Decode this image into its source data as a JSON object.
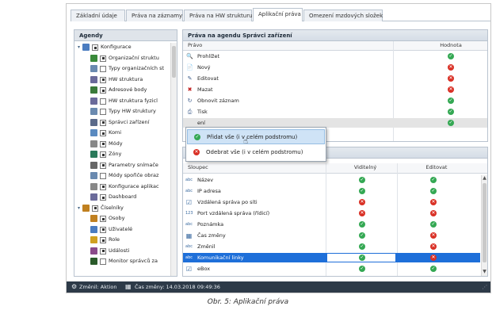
{
  "tabs": [
    "Základní údaje",
    "Práva na záznamy",
    "Práva na HW strukturu",
    "Aplikační práva",
    "Omezení mzdových složek"
  ],
  "left_panel": {
    "title": "Agendy"
  },
  "tree": [
    {
      "label": "Konfigurace",
      "indent": 0,
      "expander": "▾",
      "check": "full",
      "icon_color": "#4a7cc0"
    },
    {
      "label": "Organizační struktu",
      "indent": 1,
      "check": "full",
      "icon_color": "#3a8a3a"
    },
    {
      "label": "Typy organizačních st",
      "indent": 1,
      "check": "empty",
      "icon_color": "#6a8ab0"
    },
    {
      "label": "HW struktura",
      "indent": 1,
      "check": "full",
      "icon_color": "#6a6a9a"
    },
    {
      "label": "Adresové body",
      "indent": 1,
      "check": "full",
      "icon_color": "#3a7a3a"
    },
    {
      "label": "HW struktura fyzicl",
      "indent": 1,
      "check": "empty",
      "icon_color": "#6a6a9a"
    },
    {
      "label": "Typy HW struktury",
      "indent": 1,
      "check": "empty",
      "icon_color": "#6a8ab0"
    },
    {
      "label": "Správci zařízení",
      "indent": 1,
      "check": "full",
      "icon_color": "#5a6a8a"
    },
    {
      "label": "Komi",
      "indent": 1,
      "check": "full",
      "icon_color": "#5a8ac0"
    },
    {
      "label": "Módy",
      "indent": 1,
      "check": "full",
      "icon_color": "#888888"
    },
    {
      "label": "Zóny",
      "indent": 1,
      "check": "full",
      "icon_color": "#2a7a5a"
    },
    {
      "label": "Parametry snímače",
      "indent": 1,
      "check": "full",
      "icon_color": "#666666"
    },
    {
      "label": "Módy spořiče obraz",
      "indent": 1,
      "check": "empty",
      "icon_color": "#6a8ab0"
    },
    {
      "label": "Konfigurace aplikac",
      "indent": 1,
      "check": "full",
      "icon_color": "#888888"
    },
    {
      "label": "Dashboard",
      "indent": 1,
      "check": "full",
      "icon_color": "#6a6a9a"
    },
    {
      "label": "Číselníky",
      "indent": 0,
      "expander": "▾",
      "check": "full",
      "icon_color": "#c08020"
    },
    {
      "label": "Osoby",
      "indent": 1,
      "check": "full",
      "icon_color": "#c08020"
    },
    {
      "label": "Uživatelé",
      "indent": 1,
      "check": "full",
      "icon_color": "#4a7cc0"
    },
    {
      "label": "Role",
      "indent": 1,
      "check": "full",
      "icon_color": "#d0a020"
    },
    {
      "label": "Události",
      "indent": 1,
      "check": "full",
      "icon_color": "#8a4a8a"
    },
    {
      "label": "Monitor správců za",
      "indent": 1,
      "check": "empty",
      "icon_color": "#2a5a2a"
    }
  ],
  "rights_panel": {
    "title": "Práva na agendu Správci zařízení",
    "col_right": "Právo",
    "col_value": "Hodnota",
    "rows": [
      {
        "icon": "magnifier-icon",
        "glyph": "🔍",
        "label": "Prohlížet",
        "value": "ok"
      },
      {
        "icon": "new-doc-icon",
        "glyph": "📄",
        "label": "Nový",
        "value": "no"
      },
      {
        "icon": "edit-icon",
        "glyph": "✎",
        "label": "Editovat",
        "value": "no"
      },
      {
        "icon": "delete-icon",
        "glyph": "✖",
        "label": "Mazat",
        "value": "no"
      },
      {
        "icon": "refresh-icon",
        "glyph": "↻",
        "label": "Obnovit záznam",
        "value": "ok"
      },
      {
        "icon": "print-icon",
        "glyph": "⎙",
        "label": "Tisk",
        "value": "ok"
      },
      {
        "icon": "generic-icon",
        "glyph": "",
        "label": "ení",
        "value": "ok"
      }
    ]
  },
  "columns_panel": {
    "title": "y Správci zařízení",
    "col_column": "Sloupec",
    "col_visible": "Viditelný",
    "col_editable": "Editovat",
    "rows": [
      {
        "type": "abc",
        "label": "Název",
        "visible": "ok",
        "editable": "ok"
      },
      {
        "type": "abc",
        "label": "IP adresa",
        "visible": "ok",
        "editable": "ok"
      },
      {
        "type": "chk",
        "label": "Vzdálená správa po síti",
        "visible": "no",
        "editable": "no"
      },
      {
        "type": "123",
        "label": "Port vzdálená správa (řídicí)",
        "visible": "no",
        "editable": "no"
      },
      {
        "type": "abc",
        "label": "Poznámka",
        "visible": "ok",
        "editable": "ok"
      },
      {
        "type": "cal",
        "label": "Čas změny",
        "visible": "ok",
        "editable": "no"
      },
      {
        "type": "abc",
        "label": "Změnil",
        "visible": "ok",
        "editable": "no"
      },
      {
        "type": "abc",
        "label": "Komunikační linky",
        "visible": "ok",
        "editable": "no",
        "selected": true
      },
      {
        "type": "chk",
        "label": "eBox",
        "visible": "ok",
        "editable": "ok"
      }
    ]
  },
  "context_menu": {
    "items": [
      {
        "label": "Přidat vše (i v celém podstromu)",
        "kind": "ok"
      },
      {
        "label": "Odebrat vše (i v celém podstromu)",
        "kind": "no"
      }
    ]
  },
  "statusbar": {
    "changed_by": "Změnil: Aktion",
    "changed_at": "Čas změny: 14.03.2018 09:49:36"
  },
  "caption": "Obr.  5: Aplikační práva"
}
